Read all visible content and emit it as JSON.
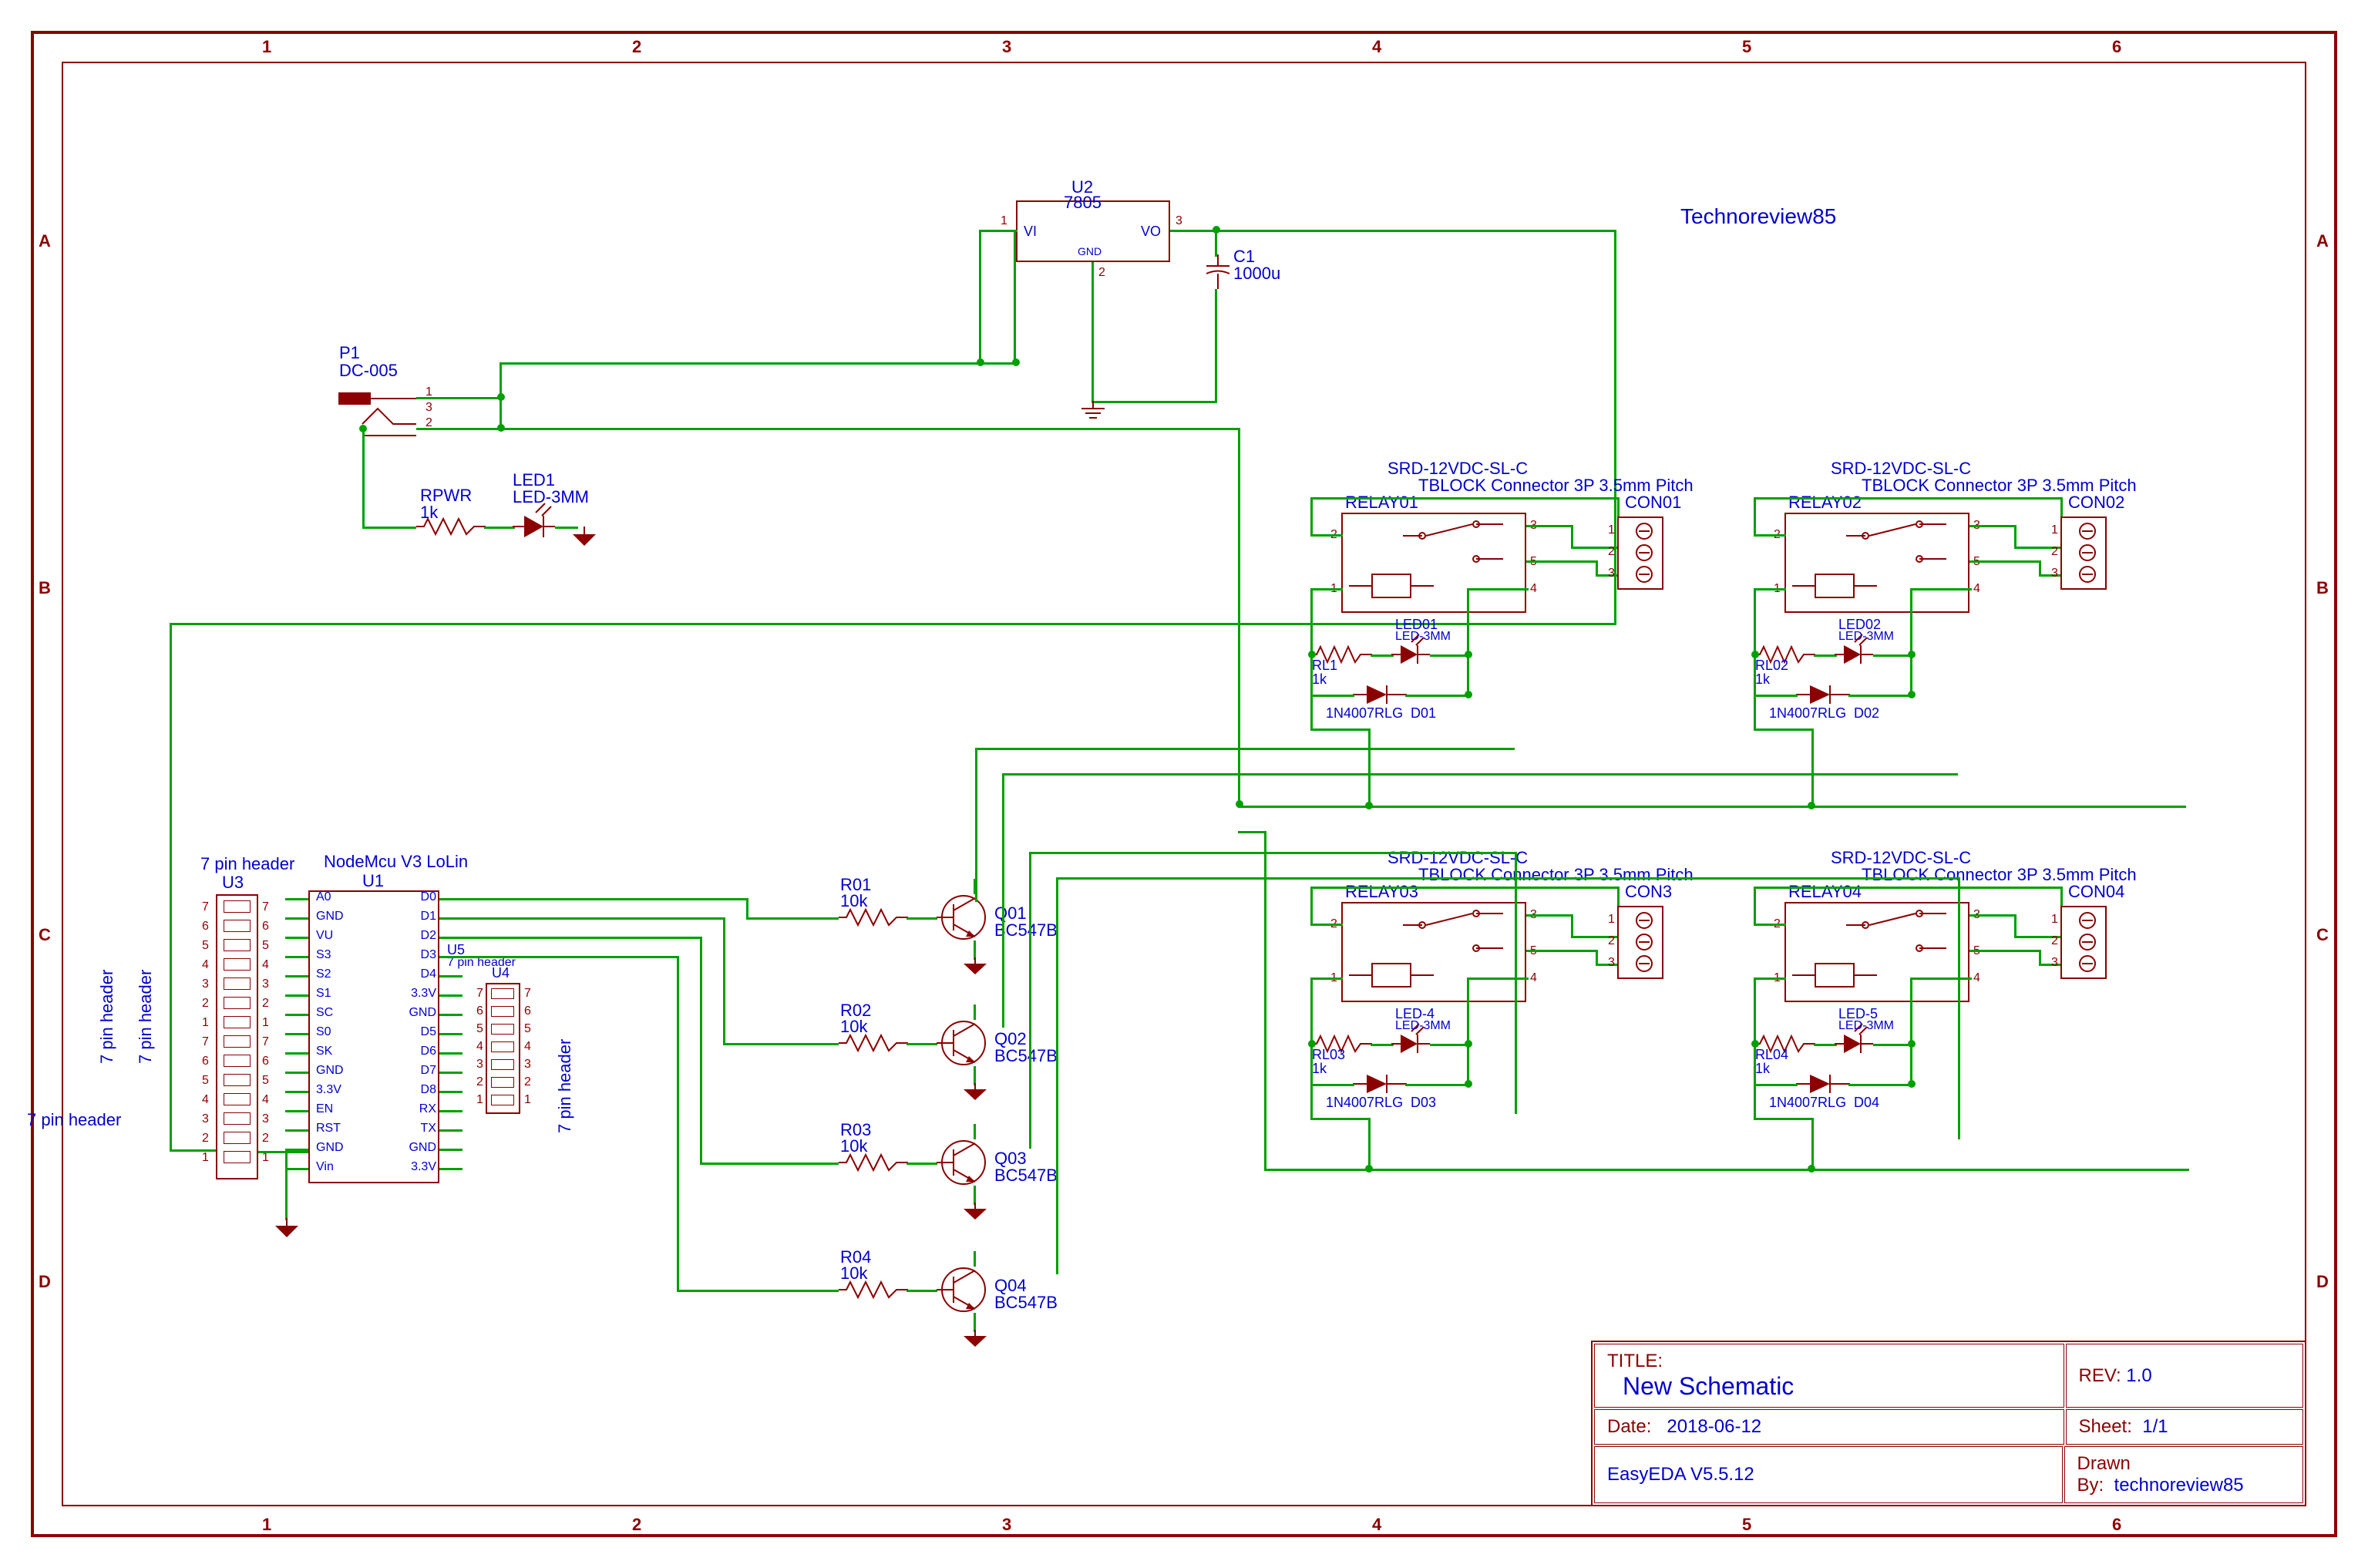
{
  "branding": "Technoreview85",
  "title_block": {
    "title_label": "TITLE:",
    "title": "New Schematic",
    "rev_label": "REV:",
    "rev": "1.0",
    "date_label": "Date:",
    "date": "2018-06-12",
    "sheet_label": "Sheet:",
    "sheet": "1/1",
    "tool": "EasyEDA V5.5.12",
    "drawn_label": "Drawn By:",
    "drawn": "technoreview85"
  },
  "side_text": {
    "left1": "7 pin header",
    "left2": "7 pin header",
    "left3": "7 pin header",
    "right": "7 pin header"
  },
  "grid_cols": [
    "1",
    "2",
    "3",
    "4",
    "5",
    "6"
  ],
  "grid_rows": [
    "A",
    "B",
    "C",
    "D"
  ],
  "power": {
    "connector_ref": "P1",
    "connector_type": "DC-005",
    "reg_ref": "U2",
    "reg_type": "7805",
    "reg_vi": "VI",
    "reg_vo": "VO",
    "reg_gnd": "GND",
    "reg_pin1": "1",
    "reg_pin2": "2",
    "reg_pin3": "3",
    "cap_ref": "C1",
    "cap_val": "1000u",
    "pwr_res_ref": "RPWR",
    "pwr_res_val": "1k",
    "pwr_led_ref": "LED1",
    "pwr_led_type": "LED-3MM"
  },
  "mcu": {
    "ref": "U1",
    "type": "NodeMcu V3 LoLin",
    "left": [
      "A0",
      "GND",
      "VU",
      "S3",
      "S2",
      "S1",
      "SC",
      "S0",
      "SK",
      "GND",
      "3.3V",
      "EN",
      "RST",
      "GND",
      "Vin"
    ],
    "right": [
      "D0",
      "D1",
      "D2",
      "D3",
      "D4",
      "3.3V",
      "GND",
      "D5",
      "D6",
      "D7",
      "D8",
      "RX",
      "TX",
      "GND",
      "3.3V"
    ]
  },
  "headers": {
    "h1_ref": "U3",
    "h1_type": "7 pin header",
    "h1_pins": [
      "7",
      "6",
      "5",
      "4",
      "3",
      "2",
      "1"
    ],
    "h1_pins2": [
      "7",
      "6",
      "5",
      "4",
      "3",
      "2",
      "1"
    ],
    "h2_ref": "U4",
    "h2_type": "7 pin header",
    "h2_pins": [
      "7",
      "6",
      "5",
      "4",
      "3",
      "2",
      "1"
    ],
    "h3_ref": "U5",
    "h3_type": "7 pin header",
    "h3_pins": [
      "6",
      "5",
      "4",
      "3",
      "2",
      "1"
    ]
  },
  "transistors": [
    {
      "r_ref": "R01",
      "r_val": "10k",
      "q_ref": "Q01",
      "q_type": "BC547B"
    },
    {
      "r_ref": "R02",
      "r_val": "10k",
      "q_ref": "Q02",
      "q_type": "BC547B"
    },
    {
      "r_ref": "R03",
      "r_val": "10k",
      "q_ref": "Q03",
      "q_type": "BC547B"
    },
    {
      "r_ref": "R04",
      "r_val": "10k",
      "q_ref": "Q04",
      "q_type": "BC547B"
    }
  ],
  "relays": [
    {
      "ref": "RELAY01",
      "type": "SRD-12VDC-SL-C",
      "con_type": "TBLOCK Connector 3P 3.5mm Pitch",
      "con_ref": "CON01",
      "led_ref": "LED01",
      "led_type": "LED-3MM",
      "rl_ref": "RL1",
      "rl_val": "1k",
      "d_ref": "D01",
      "d_type": "1N4007RLG",
      "p1": "1",
      "p2": "2",
      "p3": "3",
      "p4": "4",
      "p5": "5",
      "c1": "1",
      "c2": "2",
      "c3": "3"
    },
    {
      "ref": "RELAY02",
      "type": "SRD-12VDC-SL-C",
      "con_type": "TBLOCK Connector 3P 3.5mm Pitch",
      "con_ref": "CON02",
      "led_ref": "LED02",
      "led_type": "LED-3MM",
      "rl_ref": "RL02",
      "rl_val": "1k",
      "d_ref": "D02",
      "d_type": "1N4007RLG",
      "p1": "1",
      "p2": "2",
      "p3": "3",
      "p4": "4",
      "p5": "5",
      "c1": "1",
      "c2": "2",
      "c3": "3"
    },
    {
      "ref": "RELAY03",
      "type": "SRD-12VDC-SL-C",
      "con_type": "TBLOCK Connector 3P 3.5mm Pitch",
      "con_ref": "CON3",
      "led_ref": "LED-4",
      "led_type": "LED-3MM",
      "rl_ref": "RL03",
      "rl_val": "1k",
      "d_ref": "D03",
      "d_type": "1N4007RLG",
      "p1": "1",
      "p2": "2",
      "p3": "3",
      "p4": "4",
      "p5": "5",
      "c1": "1",
      "c2": "2",
      "c3": "3"
    },
    {
      "ref": "RELAY04",
      "type": "SRD-12VDC-SL-C",
      "con_type": "TBLOCK Connector 3P 3.5mm Pitch",
      "con_ref": "CON04",
      "led_ref": "LED-5",
      "led_type": "LED-3MM",
      "rl_ref": "RL04",
      "rl_val": "1k",
      "d_ref": "D04",
      "d_type": "1N4007RLG",
      "p1": "1",
      "p2": "2",
      "p3": "3",
      "p4": "4",
      "p5": "5",
      "c1": "1",
      "c2": "2",
      "c3": "3"
    }
  ]
}
